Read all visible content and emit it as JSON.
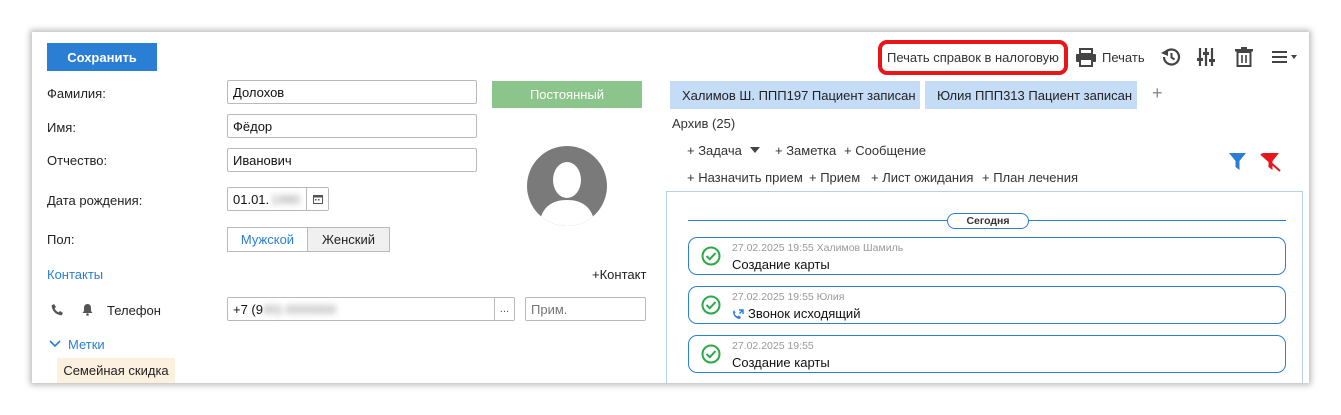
{
  "toolbar": {
    "save_label": "Сохранить",
    "print_tax_label": "Печать справок в налоговую",
    "print_label": "Печать"
  },
  "form": {
    "surname_label": "Фамилия:",
    "surname_value": "Долохов",
    "name_label": "Имя:",
    "name_value": "Фёдор",
    "patronymic_label": "Отчество:",
    "patronymic_value": "Иванович",
    "birthdate_label": "Дата рождения:",
    "birthdate_value": "01.01.",
    "birthdate_hidden": "1990",
    "gender_label": "Пол:",
    "gender_male": "Мужской",
    "gender_female": "Женский",
    "status_tag": "Постоянный"
  },
  "contacts": {
    "header": "Контакты",
    "add_contact": "+Контакт",
    "phone_label": "Телефон",
    "phone_value": "+7 (9",
    "phone_hidden": "00) 0000000",
    "phone_more": "...",
    "note_placeholder": "Прим."
  },
  "tags": {
    "header": "Метки",
    "item": "Семейная скидка"
  },
  "patient_tabs": [
    {
      "label": "Халимов Ш. ППП197  Пациент записан"
    },
    {
      "label": "Юлия ППП313  Пациент записан"
    }
  ],
  "add_tab": "+",
  "archive": "Архив (25)",
  "actions": {
    "task": "+ Задача",
    "note": "+ Заметка",
    "message": "+ Сообщение",
    "assign": "+ Назначить прием",
    "reception": "+ Прием",
    "waitlist": "+ Лист ожидания",
    "plan": "+ План лечения"
  },
  "feed": {
    "today": "Сегодня",
    "items": [
      {
        "meta": "27.02.2025 19:55 Халимов Шамиль",
        "title": "Создание карты"
      },
      {
        "meta": "27.02.2025 19:55 Юлия",
        "title": "Звонок исходящий"
      },
      {
        "meta": "27.02.2025 19:55",
        "title": "Создание карты"
      }
    ]
  },
  "colors": {
    "accent": "#2a7fd4",
    "status_green": "#8cc58c",
    "tab_bg": "#c4dcf5",
    "annotation_red": "#e8151b",
    "check_green": "#2ea84a"
  }
}
